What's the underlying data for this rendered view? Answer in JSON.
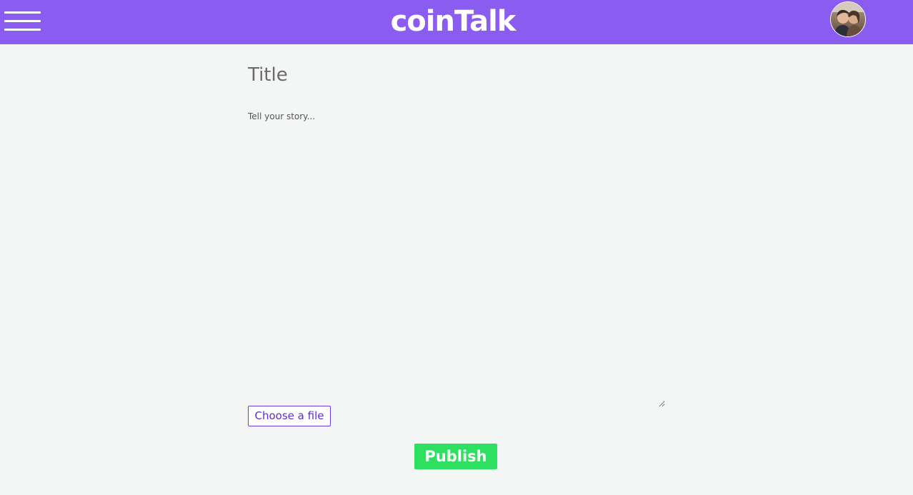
{
  "header": {
    "logo_text": "coinTalk",
    "menu_icon": "hamburger-menu-icon",
    "avatar_icon": "user-avatar-photo",
    "bar_color": "#8b5cf0"
  },
  "editor": {
    "title_placeholder": "Title",
    "title_value": "",
    "story_placeholder": "Tell your story...",
    "story_value": "",
    "file_button_label": "Choose a file",
    "publish_label": "Publish",
    "publish_color": "#2ee05f",
    "file_button_color": "#6a3be0"
  }
}
